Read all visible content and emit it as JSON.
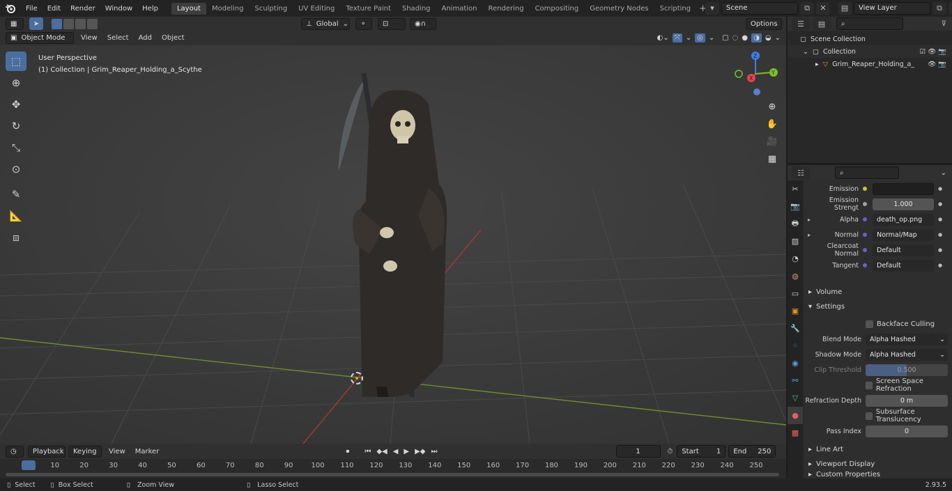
{
  "top_menu": [
    "File",
    "Edit",
    "Render",
    "Window",
    "Help"
  ],
  "workspace_tabs": [
    "Layout",
    "Modeling",
    "Sculpting",
    "UV Editing",
    "Texture Paint",
    "Shading",
    "Animation",
    "Rendering",
    "Compositing",
    "Geometry Nodes",
    "Scripting"
  ],
  "active_tab": "Layout",
  "scene_name": "Scene",
  "view_layer": "View Layer",
  "viewport": {
    "mode": "Object Mode",
    "menus": [
      "View",
      "Select",
      "Add",
      "Object"
    ],
    "transform_orientation": "Global",
    "options_label": "Options",
    "perspective_label": "User Perspective",
    "collection_label": "(1) Collection | Grim_Reaper_Holding_a_Scythe",
    "gizmo_axes": {
      "x": "X",
      "y": "Y",
      "z": "Z"
    }
  },
  "toolbar_tools": [
    "select-box-icon",
    "cursor-icon",
    "move-icon",
    "rotate-icon",
    "scale-icon",
    "transform-icon",
    "annotate-icon",
    "measure-icon",
    "add-cube-icon"
  ],
  "outliner": {
    "root": "Scene Collection",
    "collection": "Collection",
    "object": "Grim_Reaper_Holding_a_"
  },
  "properties": {
    "rows": [
      {
        "label": "Emission",
        "value": "",
        "kind": "color",
        "dot": "#c7c73a"
      },
      {
        "label": "Emission Strengt",
        "value": "1.000",
        "kind": "number",
        "dot": "#a0a0a0"
      },
      {
        "label": "Alpha",
        "value": "death_op.png",
        "kind": "link",
        "dot": "#6363c7",
        "expand": true
      },
      {
        "label": "Normal",
        "value": "Normal/Map",
        "kind": "link",
        "dot": "#6363c7",
        "expand": true
      },
      {
        "label": "Clearcoat Normal",
        "value": "Default",
        "kind": "link",
        "dot": "#6363c7"
      },
      {
        "label": "Tangent",
        "value": "Default",
        "kind": "link",
        "dot": "#6363c7"
      }
    ],
    "volume": "Volume",
    "settings": "Settings",
    "backface": "Backface Culling",
    "blend_label": "Blend Mode",
    "blend_value": "Alpha Hashed",
    "shadow_label": "Shadow Mode",
    "shadow_value": "Alpha Hashed",
    "clip_label": "Clip Threshold",
    "clip_value": "0.500",
    "clip_fill": 0.5,
    "ssr": "Screen Space Refraction",
    "refdepth_label": "Refraction Depth",
    "refdepth_value": "0 m",
    "subsurface": "Subsurface Translucency",
    "pass_label": "Pass Index",
    "pass_value": "0",
    "line_art": "Line Art",
    "viewport_display": "Viewport Display",
    "custom_props": "Custom Properties"
  },
  "timeline": {
    "menus": [
      "Playback",
      "Keying",
      "View",
      "Marker"
    ],
    "current_frame": "1",
    "start_label": "Start",
    "start_value": "1",
    "end_label": "End",
    "end_value": "250",
    "ticks": [
      "1",
      "10",
      "20",
      "30",
      "40",
      "50",
      "60",
      "70",
      "80",
      "90",
      "100",
      "110",
      "120",
      "130",
      "140",
      "150",
      "160",
      "170",
      "180",
      "190",
      "200",
      "210",
      "220",
      "230",
      "240",
      "250"
    ]
  },
  "status": {
    "select": "Select",
    "box_select": "Box Select",
    "zoom_view": "Zoom View",
    "lasso_select": "Lasso Select",
    "version": "2.93.5"
  }
}
